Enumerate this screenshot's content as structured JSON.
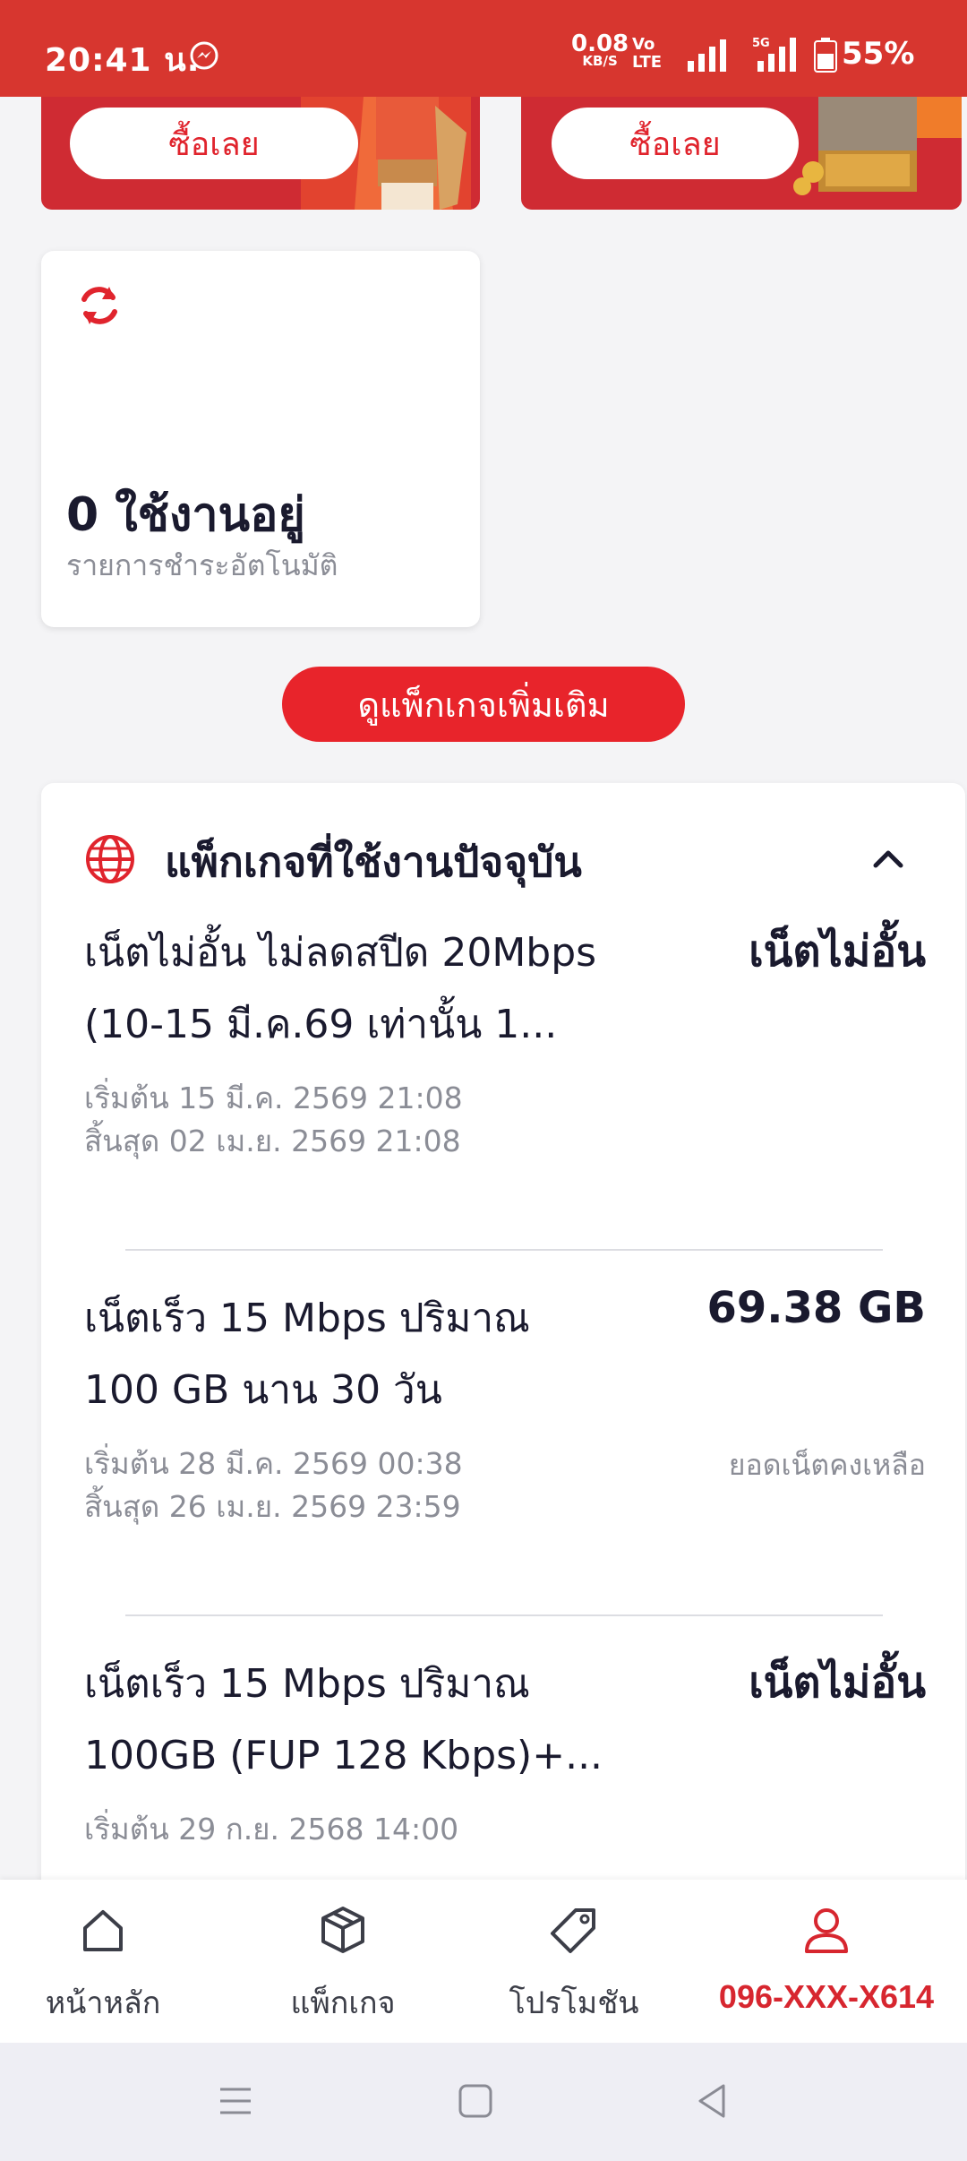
{
  "status_bar": {
    "time": "20:41 น.",
    "net_speed": "0.08",
    "net_unit": "KB/S",
    "volte_top": "Vo",
    "volte_bottom": "LTE",
    "network": "5G",
    "battery": "55%"
  },
  "promos": [
    {
      "buy_label": "ซื้อเลย"
    },
    {
      "buy_label": "ซื้อเลย"
    }
  ],
  "autopay": {
    "count": "0 ใช้งานอยู่",
    "label": "รายการชำระอัตโนมัติ"
  },
  "more_packages_label": "ดูแพ็กเกจเพิ่มเติม",
  "active_packages": {
    "title": "แพ็กเกจที่ใช้งานปัจจุบัน",
    "items": [
      {
        "name_line1": "เน็ตไม่อั้น ไม่ลดสปีด 20Mbps",
        "name_line2": "(10-15 มี.ค.69 เท่านั้น 1...",
        "value": "เน็ตไม่อั้น",
        "start": "เริ่มต้น 15 มี.ค. 2569 21:08",
        "end": "สิ้นสุด 02 เม.ย. 2569 21:08",
        "sub": ""
      },
      {
        "name_line1": "เน็ตเร็ว 15 Mbps ปริมาณ",
        "name_line2": "100 GB นาน 30 วัน",
        "value": "69.38 GB",
        "start": "เริ่มต้น 28 มี.ค. 2569 00:38",
        "end": "สิ้นสุด 26 เม.ย. 2569 23:59",
        "sub": "ยอดเน็ตคงเหลือ"
      },
      {
        "name_line1": "เน็ตเร็ว 15 Mbps ปริมาณ",
        "name_line2": "100GB (FUP 128 Kbps)+...",
        "value": "เน็ตไม่อั้น",
        "start": "เริ่มต้น 29 ก.ย. 2568 14:00",
        "end": "",
        "sub": ""
      }
    ]
  },
  "bottom_nav": {
    "items": [
      {
        "label": "หน้าหลัก",
        "icon": "home-icon"
      },
      {
        "label": "แพ็กเกจ",
        "icon": "package-icon"
      },
      {
        "label": "โปรโมชัน",
        "icon": "tag-icon"
      },
      {
        "label": "096-XXX-X614",
        "icon": "user-icon"
      }
    ],
    "active_color": "#d7262f"
  },
  "colors": {
    "brand_red": "#d7362f",
    "button_red": "#e8242b"
  }
}
